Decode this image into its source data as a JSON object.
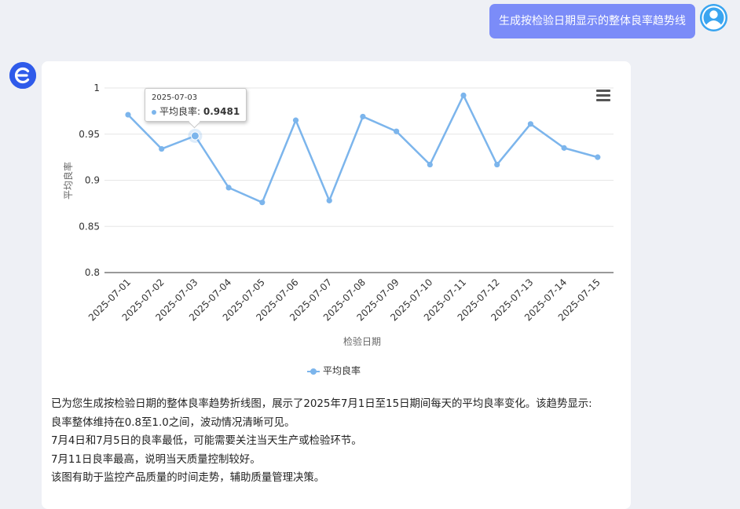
{
  "user_message": "生成按检验日期显示的整体良率趋势线",
  "chart_data": {
    "type": "line",
    "x": [
      "2025-07-01",
      "2025-07-02",
      "2025-07-03",
      "2025-07-04",
      "2025-07-05",
      "2025-07-06",
      "2025-07-07",
      "2025-07-08",
      "2025-07-09",
      "2025-07-10",
      "2025-07-11",
      "2025-07-12",
      "2025-07-13",
      "2025-07-14",
      "2025-07-15"
    ],
    "series": [
      {
        "name": "平均良率",
        "values": [
          0.971,
          0.934,
          0.9481,
          0.892,
          0.876,
          0.965,
          0.878,
          0.969,
          0.953,
          0.917,
          0.992,
          0.917,
          0.961,
          0.935,
          0.925
        ]
      }
    ],
    "yticks": [
      "1",
      "0.95",
      "0.9",
      "0.85",
      "0.8"
    ],
    "ylim": [
      0.8,
      1.0
    ],
    "xlabel": "检验日期",
    "ylabel": "平均良率",
    "grid": true,
    "legend": "bottom-center",
    "color": "#7cb5ec",
    "tooltip": {
      "date": "2025-07-03",
      "label": "平均良率: ",
      "value": "0.9481",
      "index": 2
    }
  },
  "description": {
    "lines": [
      "已为您生成按检验日期的整体良率趋势折线图，展示了2025年7月1日至15日期间每天的平均良率变化。该趋势显示:",
      "良率整体维持在0.8至1.0之间，波动情况清晰可见。",
      "7月4日和7月5日的良率最低，可能需要关注当天生产或检验环节。",
      "7月11日良率最高，说明当天质量控制较好。",
      "该图有助于监控产品质量的时间走势，辅助质量管理决策。"
    ]
  },
  "icons": {
    "user_avatar": "user-icon",
    "bot_avatar": "e-logo-icon",
    "menu": "hamburger-menu-icon"
  }
}
